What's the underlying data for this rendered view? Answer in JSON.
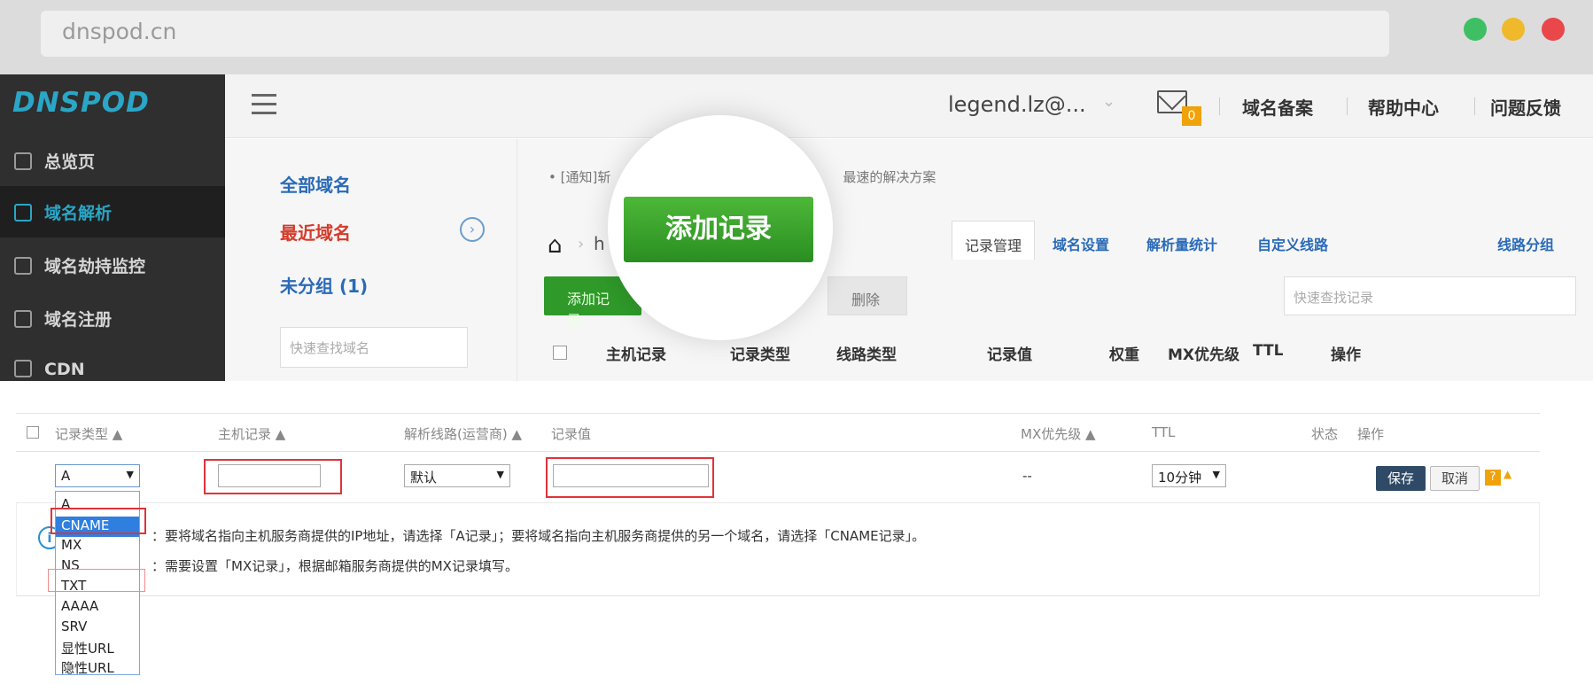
{
  "browser": {
    "url": "dnspod.cn",
    "colors": {
      "close": "#e9474a",
      "minimize": "#f0b92b",
      "maximize": "#3fbf63"
    }
  },
  "brand": {
    "logo": "DNSPOD",
    "accent": "#2aa6c6"
  },
  "sidebar": {
    "items": [
      {
        "label": "总览页",
        "icon": "home-icon"
      },
      {
        "label": "域名解析",
        "icon": "monitor-icon",
        "active": true
      },
      {
        "label": "域名劫持监控",
        "icon": "shield-icon"
      },
      {
        "label": "域名注册",
        "icon": "register-icon"
      },
      {
        "label": "CDN",
        "icon": "cdn-icon"
      }
    ]
  },
  "header": {
    "user": "legend.lz@...",
    "mail_count": "0",
    "links": [
      "域名备案",
      "帮助中心",
      "问题反馈"
    ]
  },
  "domain_list": {
    "all": "全部域名",
    "recent": "最近域名",
    "ungrouped": "未分组 (1)",
    "search_placeholder": "快速查找域名"
  },
  "main": {
    "notice_left": "• [通知]斩",
    "notice_right": "最速的解决方案",
    "breadcrumb_tail": "h",
    "tabs": [
      "记录管理",
      "域名设置",
      "解析量统计",
      "自定义线路",
      "线路分组"
    ],
    "add_small": "添加记录",
    "delete": "删除",
    "search_placeholder": "快速查找记录",
    "columns": [
      "主机记录",
      "记录类型",
      "线路类型",
      "记录值",
      "权重",
      "MX优先级",
      "TTL",
      "操作"
    ],
    "spotlight_button": "添加记录"
  },
  "editor": {
    "columns": {
      "type": "记录类型 ▲",
      "host": "主机记录 ▲",
      "line": "解析线路(运营商) ▲",
      "value": "记录值",
      "mx": "MX优先级 ▲",
      "ttl": "TTL",
      "status": "状态",
      "ops": "操作"
    },
    "row": {
      "type_selected": "A",
      "line_selected": "默认",
      "mx_value": "--",
      "ttl_selected": "10分钟",
      "save": "保存",
      "cancel": "取消",
      "help": "?"
    },
    "type_options": [
      "A",
      "CNAME",
      "MX",
      "NS",
      "TXT",
      "AAAA",
      "SRV",
      "显性URL",
      "隐性URL"
    ],
    "active_option": "CNAME",
    "hint_lines": [
      "：要将域名指向主机服务商提供的IP地址，请选择「A记录」；要将域名指向主机服务商提供的另一个域名，请选择「CNAME记录」。",
      "：需要设置「MX记录」，根据邮箱服务商提供的MX记录填写。"
    ]
  }
}
